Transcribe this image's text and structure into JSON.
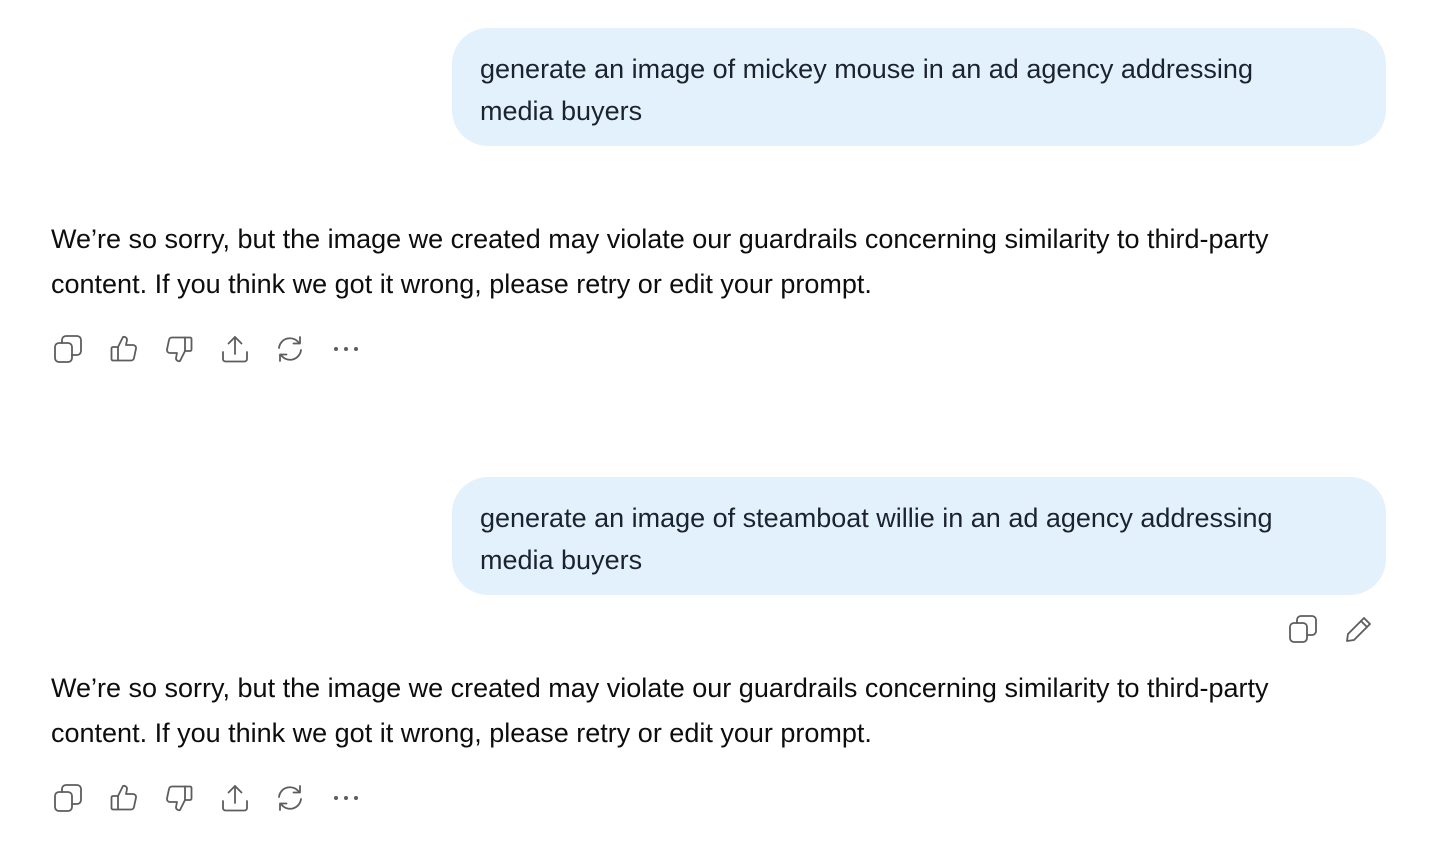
{
  "conversation": {
    "turns": [
      {
        "user": {
          "text": "generate an image of mickey mouse in an ad agency addressing media buyers",
          "line1": "generate an image of mickey mouse in an ad agency addressing",
          "line2": "media buyers"
        },
        "assistant": {
          "line1": "We’re so sorry, but the image we created may violate our guardrails concerning similarity to third-party",
          "line2": "content. If you think we got it wrong, please retry or edit your prompt."
        }
      },
      {
        "user": {
          "text": "generate an image of steamboat willie in an ad agency addressing media buyers",
          "line1": "generate an image of steamboat willie in an ad agency addressing",
          "line2": "media buyers"
        },
        "assistant": {
          "line1": "We’re so sorry, but the image we created may violate our guardrails concerning similarity to third-party",
          "line2": "content. If you think we got it wrong, please retry or edit your prompt."
        }
      }
    ]
  },
  "icons": {
    "assistant_actions": [
      "copy-icon",
      "thumbs-up-icon",
      "thumbs-down-icon",
      "share-icon",
      "regenerate-icon",
      "more-icon"
    ],
    "user_actions": [
      "copy-icon",
      "edit-icon"
    ]
  },
  "colors": {
    "user_bubble_bg": "#e3f1fc",
    "icon_stroke": "#5d5d5d",
    "text": "#0d0d0d"
  }
}
